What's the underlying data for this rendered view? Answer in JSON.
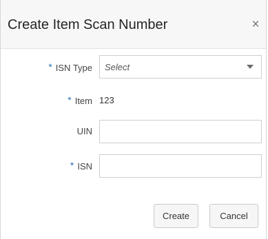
{
  "dialog": {
    "title": "Create Item Scan Number",
    "close_symbol": "×"
  },
  "form": {
    "required_marker": "*",
    "isn_type": {
      "label": "ISN Type",
      "value": "Select",
      "required": true
    },
    "item": {
      "label": "Item",
      "value": "123",
      "required": true
    },
    "uin": {
      "label": "UIN",
      "value": "",
      "required": false
    },
    "isn": {
      "label": "ISN",
      "value": "",
      "required": true
    }
  },
  "footer": {
    "create_label": "Create",
    "cancel_label": "Cancel"
  },
  "colors": {
    "required_marker": "#2f6fb3",
    "header_background": "#f7f7f7"
  },
  "icons": {
    "close": "close-icon",
    "dropdown": "chevron-down-icon"
  }
}
